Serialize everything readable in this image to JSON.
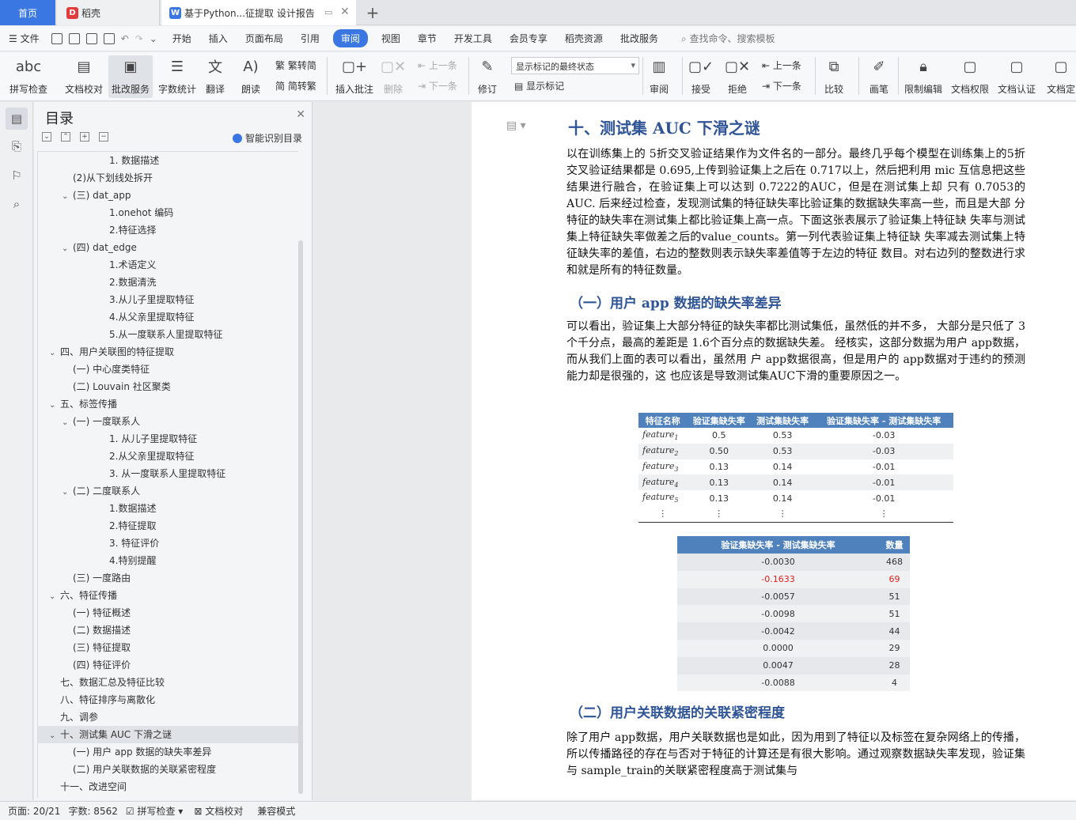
{
  "titlebar": {
    "home": "首页",
    "tab_daoke": "稻壳",
    "tab_doc": "基于Python...征提取 设计报告",
    "add": "+"
  },
  "menubar": {
    "file": "文件",
    "items": [
      "开始",
      "插入",
      "页面布局",
      "引用",
      "审阅",
      "视图",
      "章节",
      "开发工具",
      "会员专享",
      "稻壳资源",
      "批改服务"
    ],
    "active_index": 4,
    "search": "查找命令、搜索模板"
  },
  "ribbon": {
    "spell": "拼写检查",
    "proof": "文档校对",
    "review_service": "批改服务",
    "word_count": "字数统计",
    "translate": "翻译",
    "read": "朗读",
    "trad": "繁转简",
    "simp": "简转繁",
    "insert_comment": "插入批注",
    "delete": "删除",
    "prev_comment": "上一条",
    "next_comment": "下一条",
    "track": "修订",
    "markup_state": "显示标记的最终状态",
    "show_markup": "显示标记",
    "review": "审阅",
    "accept": "接受",
    "reject": "拒绝",
    "prev_change": "上一条",
    "next_change": "下一条",
    "compare": "比较",
    "pen": "画笔",
    "restrict": "限制编辑",
    "perm": "文档权限",
    "cert": "文档认证",
    "final": "文档定"
  },
  "toc": {
    "title": "目录",
    "smart": "智能识别目录",
    "items": [
      {
        "text": "1. 数据描述",
        "level": 3
      },
      {
        "text": "(2)从下划线处拆开",
        "level": 2
      },
      {
        "text": "(三) dat_app",
        "level": 2,
        "open": true
      },
      {
        "text": "1.onehot 编码",
        "level": 3
      },
      {
        "text": "2.特征选择",
        "level": 3
      },
      {
        "text": "(四) dat_edge",
        "level": 2,
        "open": true
      },
      {
        "text": "1.术语定义",
        "level": 3
      },
      {
        "text": "2.数据清洗",
        "level": 3
      },
      {
        "text": "3.从儿子里提取特征",
        "level": 3
      },
      {
        "text": "4.从父亲里提取特征",
        "level": 3
      },
      {
        "text": "5.从一度联系人里提取特征",
        "level": 3
      },
      {
        "text": "四、用户关联图的特征提取",
        "level": 1,
        "open": true
      },
      {
        "text": "(一) 中心度类特征",
        "level": 2
      },
      {
        "text": "(二) Louvain 社区聚类",
        "level": 2
      },
      {
        "text": "五、标签传播",
        "level": 1,
        "open": true
      },
      {
        "text": "(一) 一度联系人",
        "level": 2,
        "open": true
      },
      {
        "text": "1. 从儿子里提取特征",
        "level": 3
      },
      {
        "text": "2.从父亲里提取特征",
        "level": 3
      },
      {
        "text": "3. 从一度联系人里提取特征",
        "level": 3
      },
      {
        "text": "(二) 二度联系人",
        "level": 2,
        "open": true
      },
      {
        "text": "1.数据描述",
        "level": 3
      },
      {
        "text": "2.特征提取",
        "level": 3
      },
      {
        "text": "3. 特征评价",
        "level": 3
      },
      {
        "text": "4.特别提醒",
        "level": 3
      },
      {
        "text": "(三) 一度路由",
        "level": 2
      },
      {
        "text": "六、特征传播",
        "level": 1,
        "open": true
      },
      {
        "text": "(一) 特征概述",
        "level": 2
      },
      {
        "text": "(二) 数据描述",
        "level": 2
      },
      {
        "text": "(三) 特征提取",
        "level": 2
      },
      {
        "text": "(四) 特征评价",
        "level": 2
      },
      {
        "text": "七、数据汇总及特征比较",
        "level": 1
      },
      {
        "text": "八、特征排序与离散化",
        "level": 1
      },
      {
        "text": "九、调参",
        "level": 1
      },
      {
        "text": "十、测试集 AUC 下滑之谜",
        "level": 1,
        "open": true,
        "selected": true
      },
      {
        "text": "(一) 用户 app 数据的缺失率差异",
        "level": 2
      },
      {
        "text": "(二) 用户关联数据的关联紧密程度",
        "level": 2
      },
      {
        "text": "十一、改进空间",
        "level": 1
      }
    ]
  },
  "doc": {
    "h1": "十、测试集 AUC 下滑之谜",
    "p1": "以在训练集上的 5折交叉验证结果作为文件名的一部分。最终几乎每个模型在训练集上的5折交叉验证结果都是 0.695,上传到验证集上之后在 0.717以上，然后把利用 mic 互信息把这些结果进行融合，在验证集上可以达到 0.7222的AUC，但是在测试集上却 只有 0.7053的AUC. 后来经过检查，发现测试集的特征缺失率比验证集的数据缺失率高一些，而且是大部 分特征的缺失率在测试集上都比验证集上高一点。下面这张表展示了验证集上特征缺 失率与测试集上特征缺失率做差之后的value_counts。第一列代表验证集上特征缺 失率减去测试集上特征缺失率的差值，右边的整数则表示缺失率差值等于左边的特征 数目。对右边列的整数进行求和就是所有的特征数量。",
    "h2a": "（一）用户 app 数据的缺失率差异",
    "p2": "可以看出，验证集上大部分特征的缺失率都比测试集低，虽然低的并不多， 大部分是只低了 3个千分点，最高的差距是 1.6个百分点的数据缺失差。 经核实，这部分数据为用户 app数据，而从我们上面的表可以看出，虽然用 户 app数据很高，但是用户的 app数据对于违约的预测能力却是很强的，这 也应该是导致测试集AUC下滑的重要原因之一。",
    "table1": {
      "headers": [
        "特征名称",
        "验证集缺失率",
        "测试集缺失率",
        "验证集缺失率 - 测试集缺失率"
      ],
      "rows": [
        [
          "feature",
          "1",
          "0.5",
          "0.53",
          "-0.03"
        ],
        [
          "feature",
          "2",
          "0.50",
          "0.53",
          "-0.03"
        ],
        [
          "feature",
          "3",
          "0.13",
          "0.14",
          "-0.01"
        ],
        [
          "feature",
          "4",
          "0.13",
          "0.14",
          "-0.01"
        ],
        [
          "feature",
          "5",
          "0.13",
          "0.14",
          "-0.01"
        ]
      ],
      "ellipsis": "⋮"
    },
    "table2": {
      "headers": [
        "验证集缺失率 - 测试集缺失率",
        "数量"
      ],
      "rows": [
        [
          "-0.0030",
          "468"
        ],
        [
          "-0.1633",
          "69"
        ],
        [
          "-0.0057",
          "51"
        ],
        [
          "-0.0098",
          "51"
        ],
        [
          "-0.0042",
          "44"
        ],
        [
          "0.0000",
          "29"
        ],
        [
          "0.0047",
          "28"
        ],
        [
          "-0.0088",
          "4"
        ]
      ],
      "highlight_row": 1,
      "highlight_color": "#e02020"
    },
    "h2b": "（二）用户关联数据的关联紧密程度",
    "p3": "除了用户 app数据，用户关联数据也是如此，因为用到了特征以及标签在复杂网络上的传播，所以传播路径的存在与否对于特征的计算还是有很大影响。通过观察数据缺失率发现，验证集与 sample_train的关联紧密程度高于测试集与"
  },
  "status": {
    "page": "页面: 20/21",
    "words": "字数: 8562",
    "spell": "拼写检查",
    "proof": "文档校对",
    "compat": "兼容模式"
  },
  "colors": {
    "accent": "#3a77e2",
    "heading": "#2f5597",
    "table_header": "#4f81bd"
  }
}
